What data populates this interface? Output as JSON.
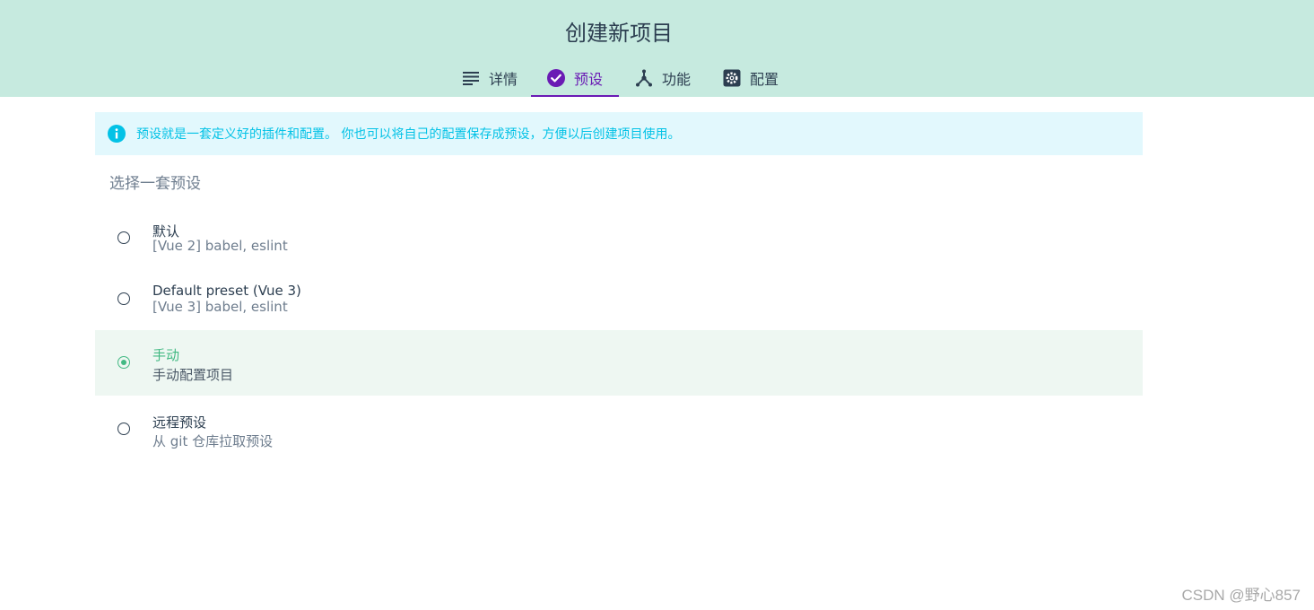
{
  "header": {
    "title": "创建新项目",
    "tabs": [
      {
        "label": "详情",
        "icon": "list-icon",
        "active": false
      },
      {
        "label": "预设",
        "icon": "check-circle-icon",
        "active": true
      },
      {
        "label": "功能",
        "icon": "merge-type-icon",
        "active": false
      },
      {
        "label": "配置",
        "icon": "settings-box-icon",
        "active": false
      }
    ]
  },
  "info": {
    "icon": "info-icon",
    "text": "预设就是一套定义好的插件和配置。 你也可以将自己的配置保存成预设，方便以后创建项目使用。"
  },
  "presets": {
    "title": "选择一套预设",
    "items": [
      {
        "name": "默认",
        "description": "[Vue 2] babel, eslint",
        "selected": false
      },
      {
        "name": "Default preset (Vue 3)",
        "description": "[Vue 3] babel, eslint",
        "selected": false
      },
      {
        "name": "手动",
        "description": "手动配置项目",
        "selected": true
      },
      {
        "name": "远程预设",
        "description": "从 git 仓库拉取预设",
        "selected": false
      }
    ]
  },
  "watermark": "CSDN @野心857",
  "colors": {
    "header_bg": "#c6eadf",
    "active_tab": "#6a1bb4",
    "info_text": "#03c2e6",
    "info_bg": "#e2f8fd",
    "selected_green": "#42b983",
    "selected_bg": "#eef7f2"
  }
}
